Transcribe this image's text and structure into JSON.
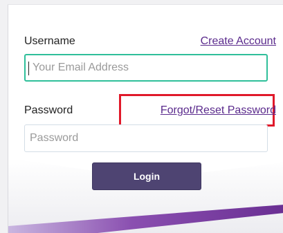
{
  "form": {
    "username_label": "Username",
    "create_account_link": "Create Account",
    "username_placeholder": "Your Email Address",
    "password_label": "Password",
    "forgot_link": "Forgot/Reset Password",
    "password_placeholder": "Password",
    "login_button": "Login"
  },
  "colors": {
    "link": "#5a2a8c",
    "focus_border": "#2fbf9a",
    "highlight": "#e0192a",
    "button_bg": "#4e4472",
    "swoosh": "#7b3fa0"
  }
}
